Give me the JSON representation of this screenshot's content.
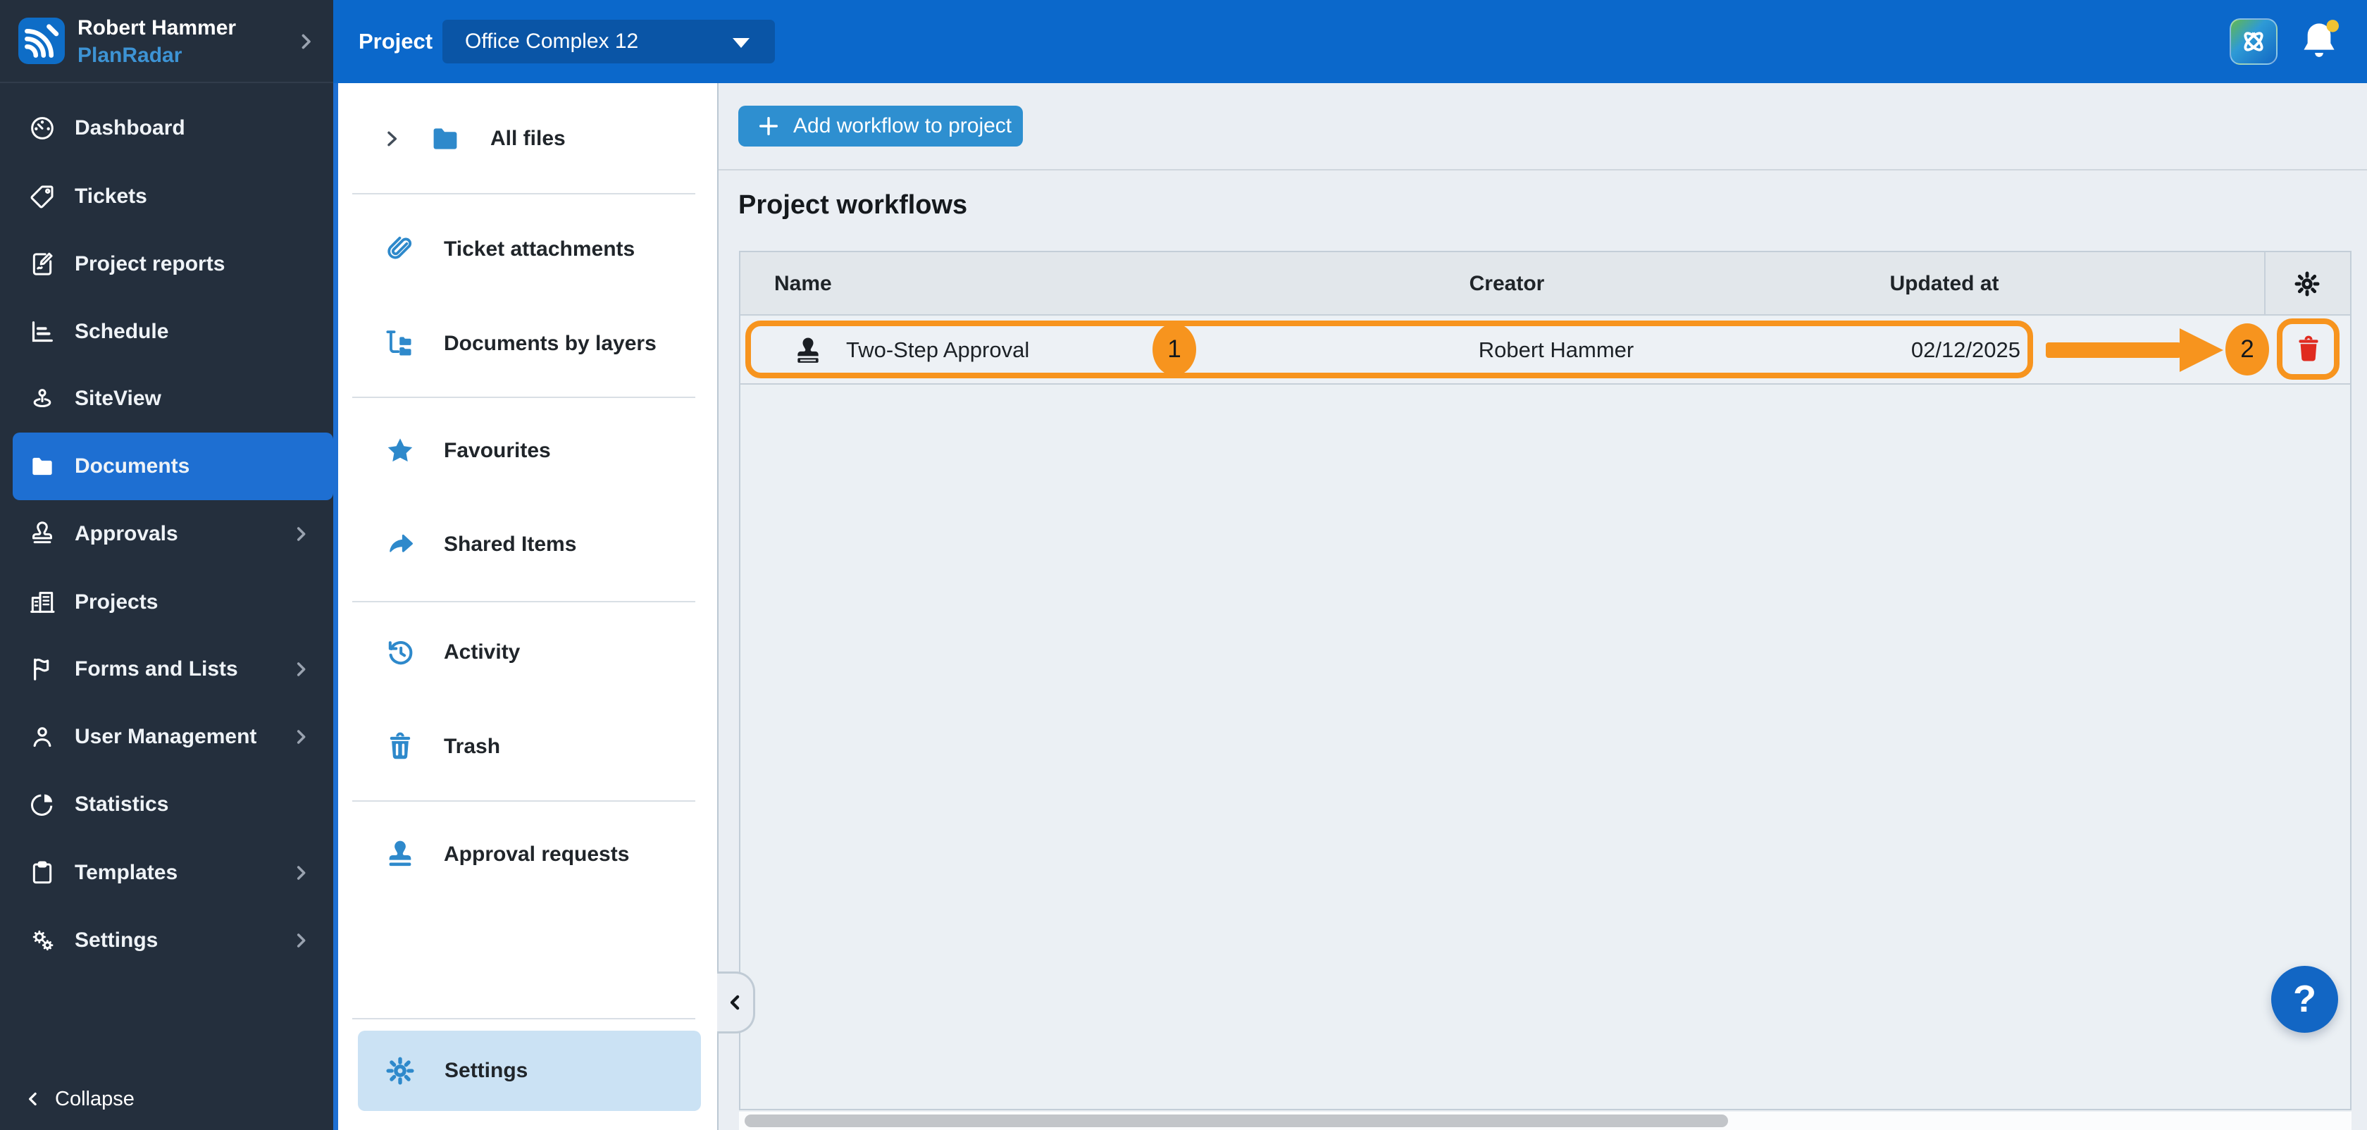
{
  "user": {
    "name": "Robert Hammer",
    "brand": "PlanRadar"
  },
  "top_bar": {
    "project_label": "Project",
    "project_value": "Office Complex 12"
  },
  "primary_sidebar": {
    "items": [
      {
        "label": "Dashboard",
        "selected": false,
        "chevron": false
      },
      {
        "label": "Tickets",
        "selected": false,
        "chevron": false
      },
      {
        "label": "Project reports",
        "selected": false,
        "chevron": false
      },
      {
        "label": "Schedule",
        "selected": false,
        "chevron": false
      },
      {
        "label": "SiteView",
        "selected": false,
        "chevron": false
      },
      {
        "label": "Documents",
        "selected": true,
        "chevron": false
      },
      {
        "label": "Approvals",
        "selected": false,
        "chevron": true
      },
      {
        "label": "Projects",
        "selected": false,
        "chevron": false
      },
      {
        "label": "Forms and Lists",
        "selected": false,
        "chevron": true
      },
      {
        "label": "User Management",
        "selected": false,
        "chevron": true
      },
      {
        "label": "Statistics",
        "selected": false,
        "chevron": false
      },
      {
        "label": "Templates",
        "selected": false,
        "chevron": true
      },
      {
        "label": "Settings",
        "selected": false,
        "chevron": true
      }
    ],
    "collapse_label": "Collapse"
  },
  "documents_panel": {
    "all_files_label": "All files",
    "items": [
      "Ticket attachments",
      "Documents by layers",
      "Favourites",
      "Shared Items",
      "Activity",
      "Trash",
      "Approval requests"
    ],
    "settings_label": "Settings"
  },
  "main": {
    "add_workflow_button": "Add workflow to project",
    "title": "Project workflows",
    "table": {
      "columns": [
        "Name",
        "Creator",
        "Updated at"
      ],
      "rows": [
        {
          "name": "Two-Step Approval",
          "creator": "Robert Hammer",
          "updated_at": "02/12/2025"
        }
      ]
    },
    "annotations": {
      "step1": "1",
      "step2": "2"
    },
    "help_label": "?"
  },
  "colors": {
    "header_blue": "#0B68CB",
    "sidebar_dark": "#242F3D",
    "accent_blue": "#1E6FD2",
    "button_blue": "#2E8FD0",
    "icon_blue": "#2E89CB",
    "selected_light_blue": "#CBE2F4",
    "annotation_orange": "#F7941E",
    "delete_red": "#E02B20",
    "notification_yellow": "#F1C232",
    "help_blue": "#1266C4"
  }
}
